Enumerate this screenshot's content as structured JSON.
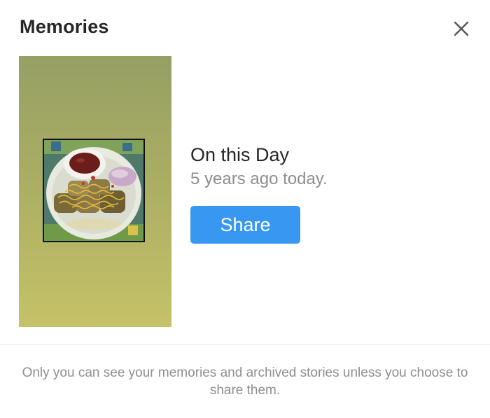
{
  "header": {
    "title": "Memories",
    "close_icon": "close-icon"
  },
  "memory": {
    "thumbnail_icon": "food-photo",
    "heading": "On this Day",
    "subtitle": "5 years ago today.",
    "share_label": "Share"
  },
  "footer": {
    "note": "Only you can see your memories and archived stories unless you choose to share them."
  },
  "colors": {
    "accent": "#3897f0",
    "text_primary": "#262626",
    "text_secondary": "#8e8e8e",
    "thumb_top": "#96a065",
    "thumb_bottom": "#c5c268"
  }
}
